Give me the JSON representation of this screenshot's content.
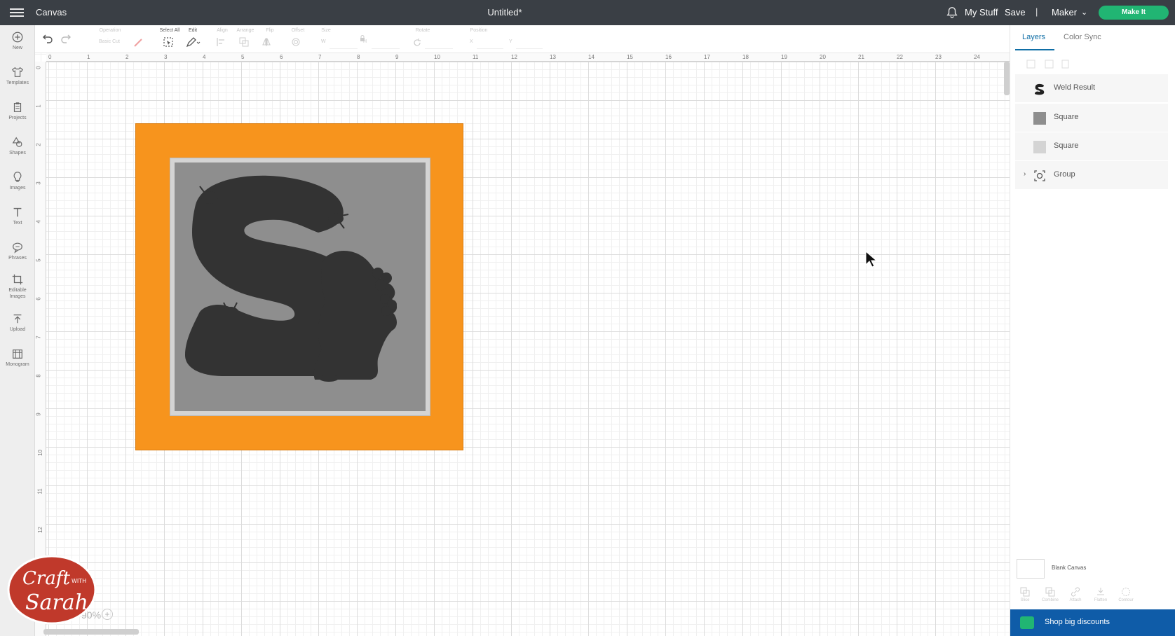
{
  "topbar": {
    "app_title": "Canvas",
    "doc_title": "Untitled*",
    "my_stuff": "My Stuff",
    "save": "Save",
    "separator": "|",
    "machine": "Maker",
    "make_it": "Make It"
  },
  "leftbar": {
    "items": [
      {
        "label": "New",
        "icon": "plus-circle-icon"
      },
      {
        "label": "Templates",
        "icon": "shirt-icon"
      },
      {
        "label": "Projects",
        "icon": "clipboard-icon"
      },
      {
        "label": "Shapes",
        "icon": "shapes-icon"
      },
      {
        "label": "Images",
        "icon": "bulb-icon"
      },
      {
        "label": "Text",
        "icon": "text-icon"
      },
      {
        "label": "Phrases",
        "icon": "speech-bubble-icon"
      },
      {
        "label": "Editable Images",
        "icon": "crop-icon"
      },
      {
        "label": "Upload",
        "icon": "upload-icon"
      },
      {
        "label": "Monogram",
        "icon": "monogram-icon"
      }
    ]
  },
  "toolbar": {
    "operation": "Operation",
    "operation_value": "Basic Cut",
    "select_all": "Select All",
    "edit": "Edit",
    "align": "Align",
    "arrange": "Arrange",
    "flip": "Flip",
    "offset": "Offset",
    "size": "Size",
    "w": "W",
    "h": "H",
    "rotate": "Rotate",
    "position": "Position",
    "x": "X",
    "y": "Y"
  },
  "ruler": {
    "top": [
      "0",
      "1",
      "2",
      "3",
      "4",
      "5",
      "6",
      "7",
      "8",
      "9",
      "10",
      "11",
      "12",
      "13",
      "14",
      "15",
      "16",
      "17",
      "18",
      "19",
      "20",
      "21",
      "22",
      "23",
      "24"
    ],
    "left": [
      "0",
      "1",
      "2",
      "3",
      "4",
      "5",
      "6",
      "7",
      "8",
      "9",
      "10",
      "11",
      "12"
    ]
  },
  "zoom": {
    "value": "90%"
  },
  "panel": {
    "tabs": [
      "Layers",
      "Color Sync"
    ],
    "layers": [
      {
        "name": "Weld Result",
        "thumb_color": "#333333"
      },
      {
        "name": "Square",
        "thumb_color": "#8e8e8e"
      },
      {
        "name": "Square",
        "thumb_color": "#d4d4d4"
      },
      {
        "name": "Group",
        "thumb_color": "#555555"
      }
    ],
    "blank_canvas": "Blank Canvas",
    "actions": [
      "Slice",
      "Combine",
      "Attach",
      "Flatten",
      "Contour"
    ],
    "banner": "Shop big discounts"
  },
  "colors": {
    "orange": "#f7941d",
    "light_gray": "#d4d4d4",
    "mid_gray": "#8e8e8e",
    "dark": "#333333",
    "make_it": "#21b573",
    "banner": "#0f5ca8"
  },
  "watermark": {
    "line1": "Craft",
    "line2": "WITH",
    "line3": "Sarah"
  }
}
